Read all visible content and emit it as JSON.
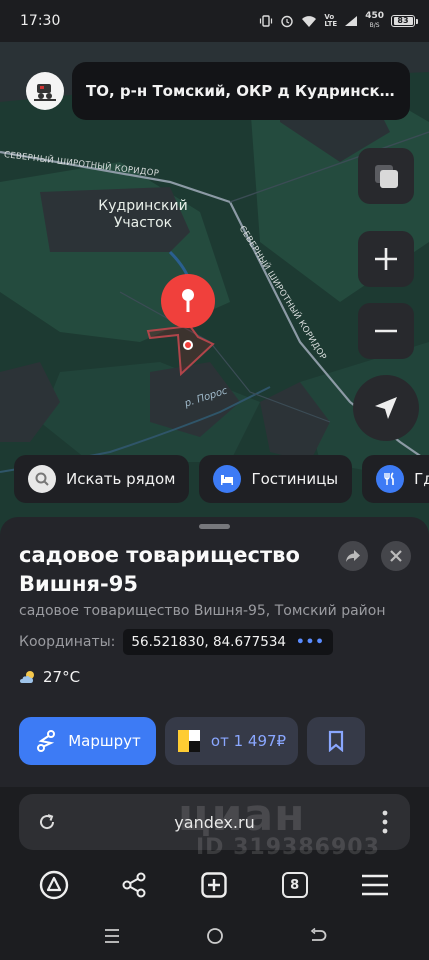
{
  "status_bar": {
    "time": "17:30",
    "net_speed": "450",
    "net_unit": "B/S",
    "battery": "83",
    "icons": [
      "vibrate-icon",
      "alarm-icon",
      "wifi-icon",
      "volte-icon",
      "signal-icon",
      "battery-icon"
    ]
  },
  "address_bar": {
    "text": "ТО, р-н Томский, ОКР д Кудринский участок",
    "logo_icon": "snowmobile-icon"
  },
  "map": {
    "labels": {
      "locality": "Кудринский Участок",
      "road_top": "СЕВЕРНЫЙ ШИРОТНЫЙ КОРИДОР",
      "road_diagonal": "СЕВЕРНЫЙ ШИРОТНЫЙ КОРИДОР",
      "river": "р. Порос"
    },
    "colors": {
      "land": "#1d3a32",
      "forest": "#234a3d",
      "field": "#2c3337",
      "road": "#8c9aa5",
      "pin": "#f0403c"
    },
    "buttons": [
      "layers-icon",
      "zoom-in-icon",
      "zoom-out-icon",
      "locate-icon"
    ]
  },
  "chips": [
    {
      "label": "Искать рядом",
      "icon": "search-icon"
    },
    {
      "label": "Гостиницы",
      "icon": "bed-icon"
    },
    {
      "label": "Гд",
      "icon": "fork-knife-icon"
    }
  ],
  "place": {
    "title_line1": "садовое товарищество",
    "title_line2": "Вишня-95",
    "subtitle": "садовое товарищество Вишня-95, Томский район",
    "coords_label": "Координаты:",
    "coords_value": "56.521830, 84.677534",
    "coords_more": "•••",
    "weather": "27°C"
  },
  "actions": {
    "route_label": "Маршрут",
    "taxi_label": "от 1 497₽",
    "accent": "#3d7bf5"
  },
  "browser": {
    "url": "yandex.ru",
    "tabs_count": "8",
    "toolbar_icons": [
      "alice-icon",
      "share-icon",
      "new-tab-icon",
      "tabs-icon",
      "menu-icon"
    ]
  },
  "watermark": {
    "logo": "циан",
    "id": "ID 319386903"
  }
}
